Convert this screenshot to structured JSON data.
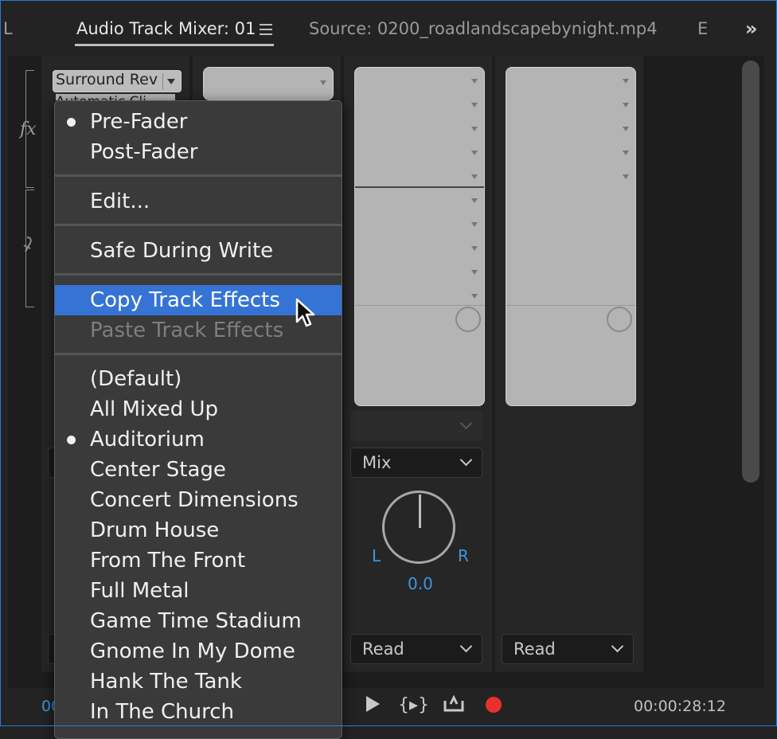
{
  "tabs": {
    "left_partial": "L",
    "mixer": "Audio Track Mixer: 01",
    "source": "Source: 0200_roadlandscapebynight.mp4",
    "right_partial": "E",
    "overflow": "»"
  },
  "effects": {
    "slot1_name": "Surround Rev",
    "slot1_name_partial": "Automatic Cli"
  },
  "channel3": {
    "mode": "Mix",
    "pan_left": "L",
    "pan_right": "R",
    "pan_value": "0.0",
    "automation": "Read"
  },
  "channel4": {
    "automation": "Read"
  },
  "transport": {
    "timecode_left": "00",
    "timecode_right": "00:00:28:12"
  },
  "menu": {
    "send_items": [
      {
        "label": "Pre-Fader",
        "checked": true
      },
      {
        "label": "Post-Fader",
        "checked": false
      }
    ],
    "edit": "Edit...",
    "safe_during_write": "Safe During Write",
    "copy_track_effects": "Copy Track Effects",
    "paste_track_effects": "Paste Track Effects",
    "presets": [
      {
        "label": "(Default)",
        "checked": false
      },
      {
        "label": "All Mixed Up",
        "checked": false
      },
      {
        "label": "Auditorium",
        "checked": true
      },
      {
        "label": "Center Stage",
        "checked": false
      },
      {
        "label": "Concert Dimensions",
        "checked": false
      },
      {
        "label": "Drum House",
        "checked": false
      },
      {
        "label": "From The Front",
        "checked": false
      },
      {
        "label": "Full Metal",
        "checked": false
      },
      {
        "label": "Game Time Stadium",
        "checked": false
      },
      {
        "label": "Gnome In My Dome",
        "checked": false
      },
      {
        "label": "Hank The Tank",
        "checked": false
      },
      {
        "label": "In The Church",
        "checked": false
      }
    ]
  },
  "colors": {
    "accent": "#3574d5",
    "record": "#e8312b",
    "pan_blue": "#3d95e6"
  }
}
